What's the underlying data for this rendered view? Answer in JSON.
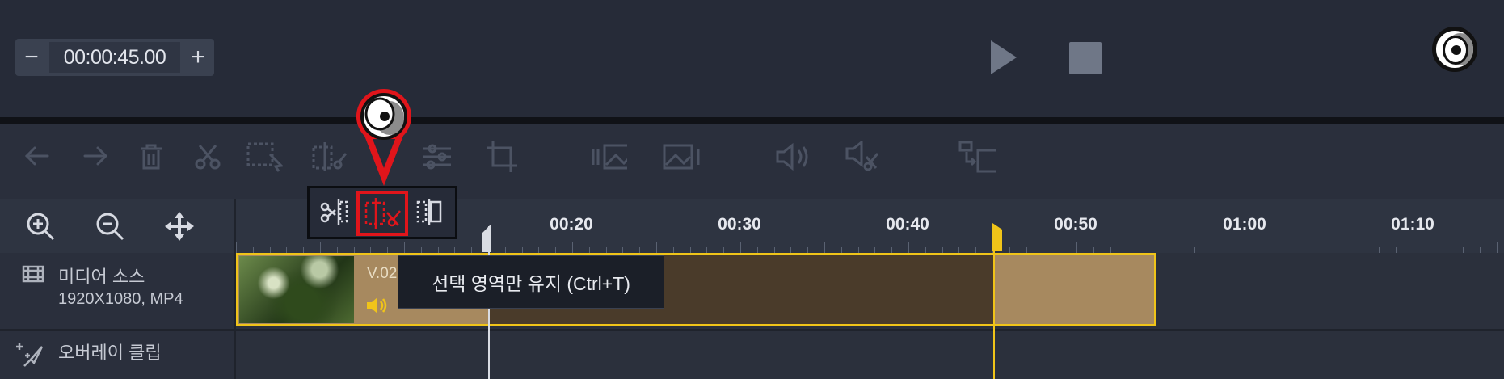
{
  "timecode": {
    "value": "00:00:45.00",
    "minus_label": "−",
    "plus_label": "+"
  },
  "ruler": {
    "ticks": [
      {
        "label": "00:20"
      },
      {
        "label": "00:30"
      },
      {
        "label": "00:40"
      },
      {
        "label": "00:50"
      },
      {
        "label": "01:00"
      },
      {
        "label": "01:10"
      }
    ]
  },
  "tracks": {
    "media": {
      "name": "미디어 소스",
      "info": "1920X1080, MP4"
    },
    "overlay": {
      "name": "오버레이 클립"
    }
  },
  "clip": {
    "label": "V.02"
  },
  "tooltip": {
    "text": "선택 영역만 유지 (Ctrl+T)"
  },
  "toolbar": {
    "icons": [
      "undo-icon",
      "redo-icon",
      "delete-icon",
      "cut-icon",
      "select-icon",
      "split-icon",
      "adjust-icon",
      "crop-icon",
      "image-left-icon",
      "image-right-icon",
      "volume-icon",
      "mute-icon",
      "replace-icon"
    ]
  },
  "colors": {
    "accent": "#f0c419",
    "highlight": "#e0151b",
    "clip": "#a7895f"
  }
}
